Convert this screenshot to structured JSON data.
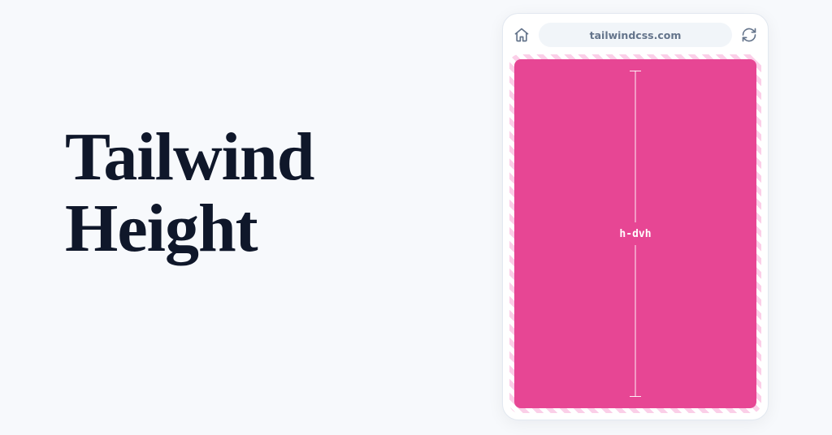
{
  "headline": {
    "line1": "Tailwind",
    "line2": "Height"
  },
  "device": {
    "url": "tailwindcss.com",
    "content_label": "h-dvh"
  },
  "colors": {
    "bg": "#f7f9fc",
    "ink": "#0f172a",
    "pink": "#e74694",
    "stripe": "#fbcfe8",
    "chrome_muted": "#64748b"
  }
}
